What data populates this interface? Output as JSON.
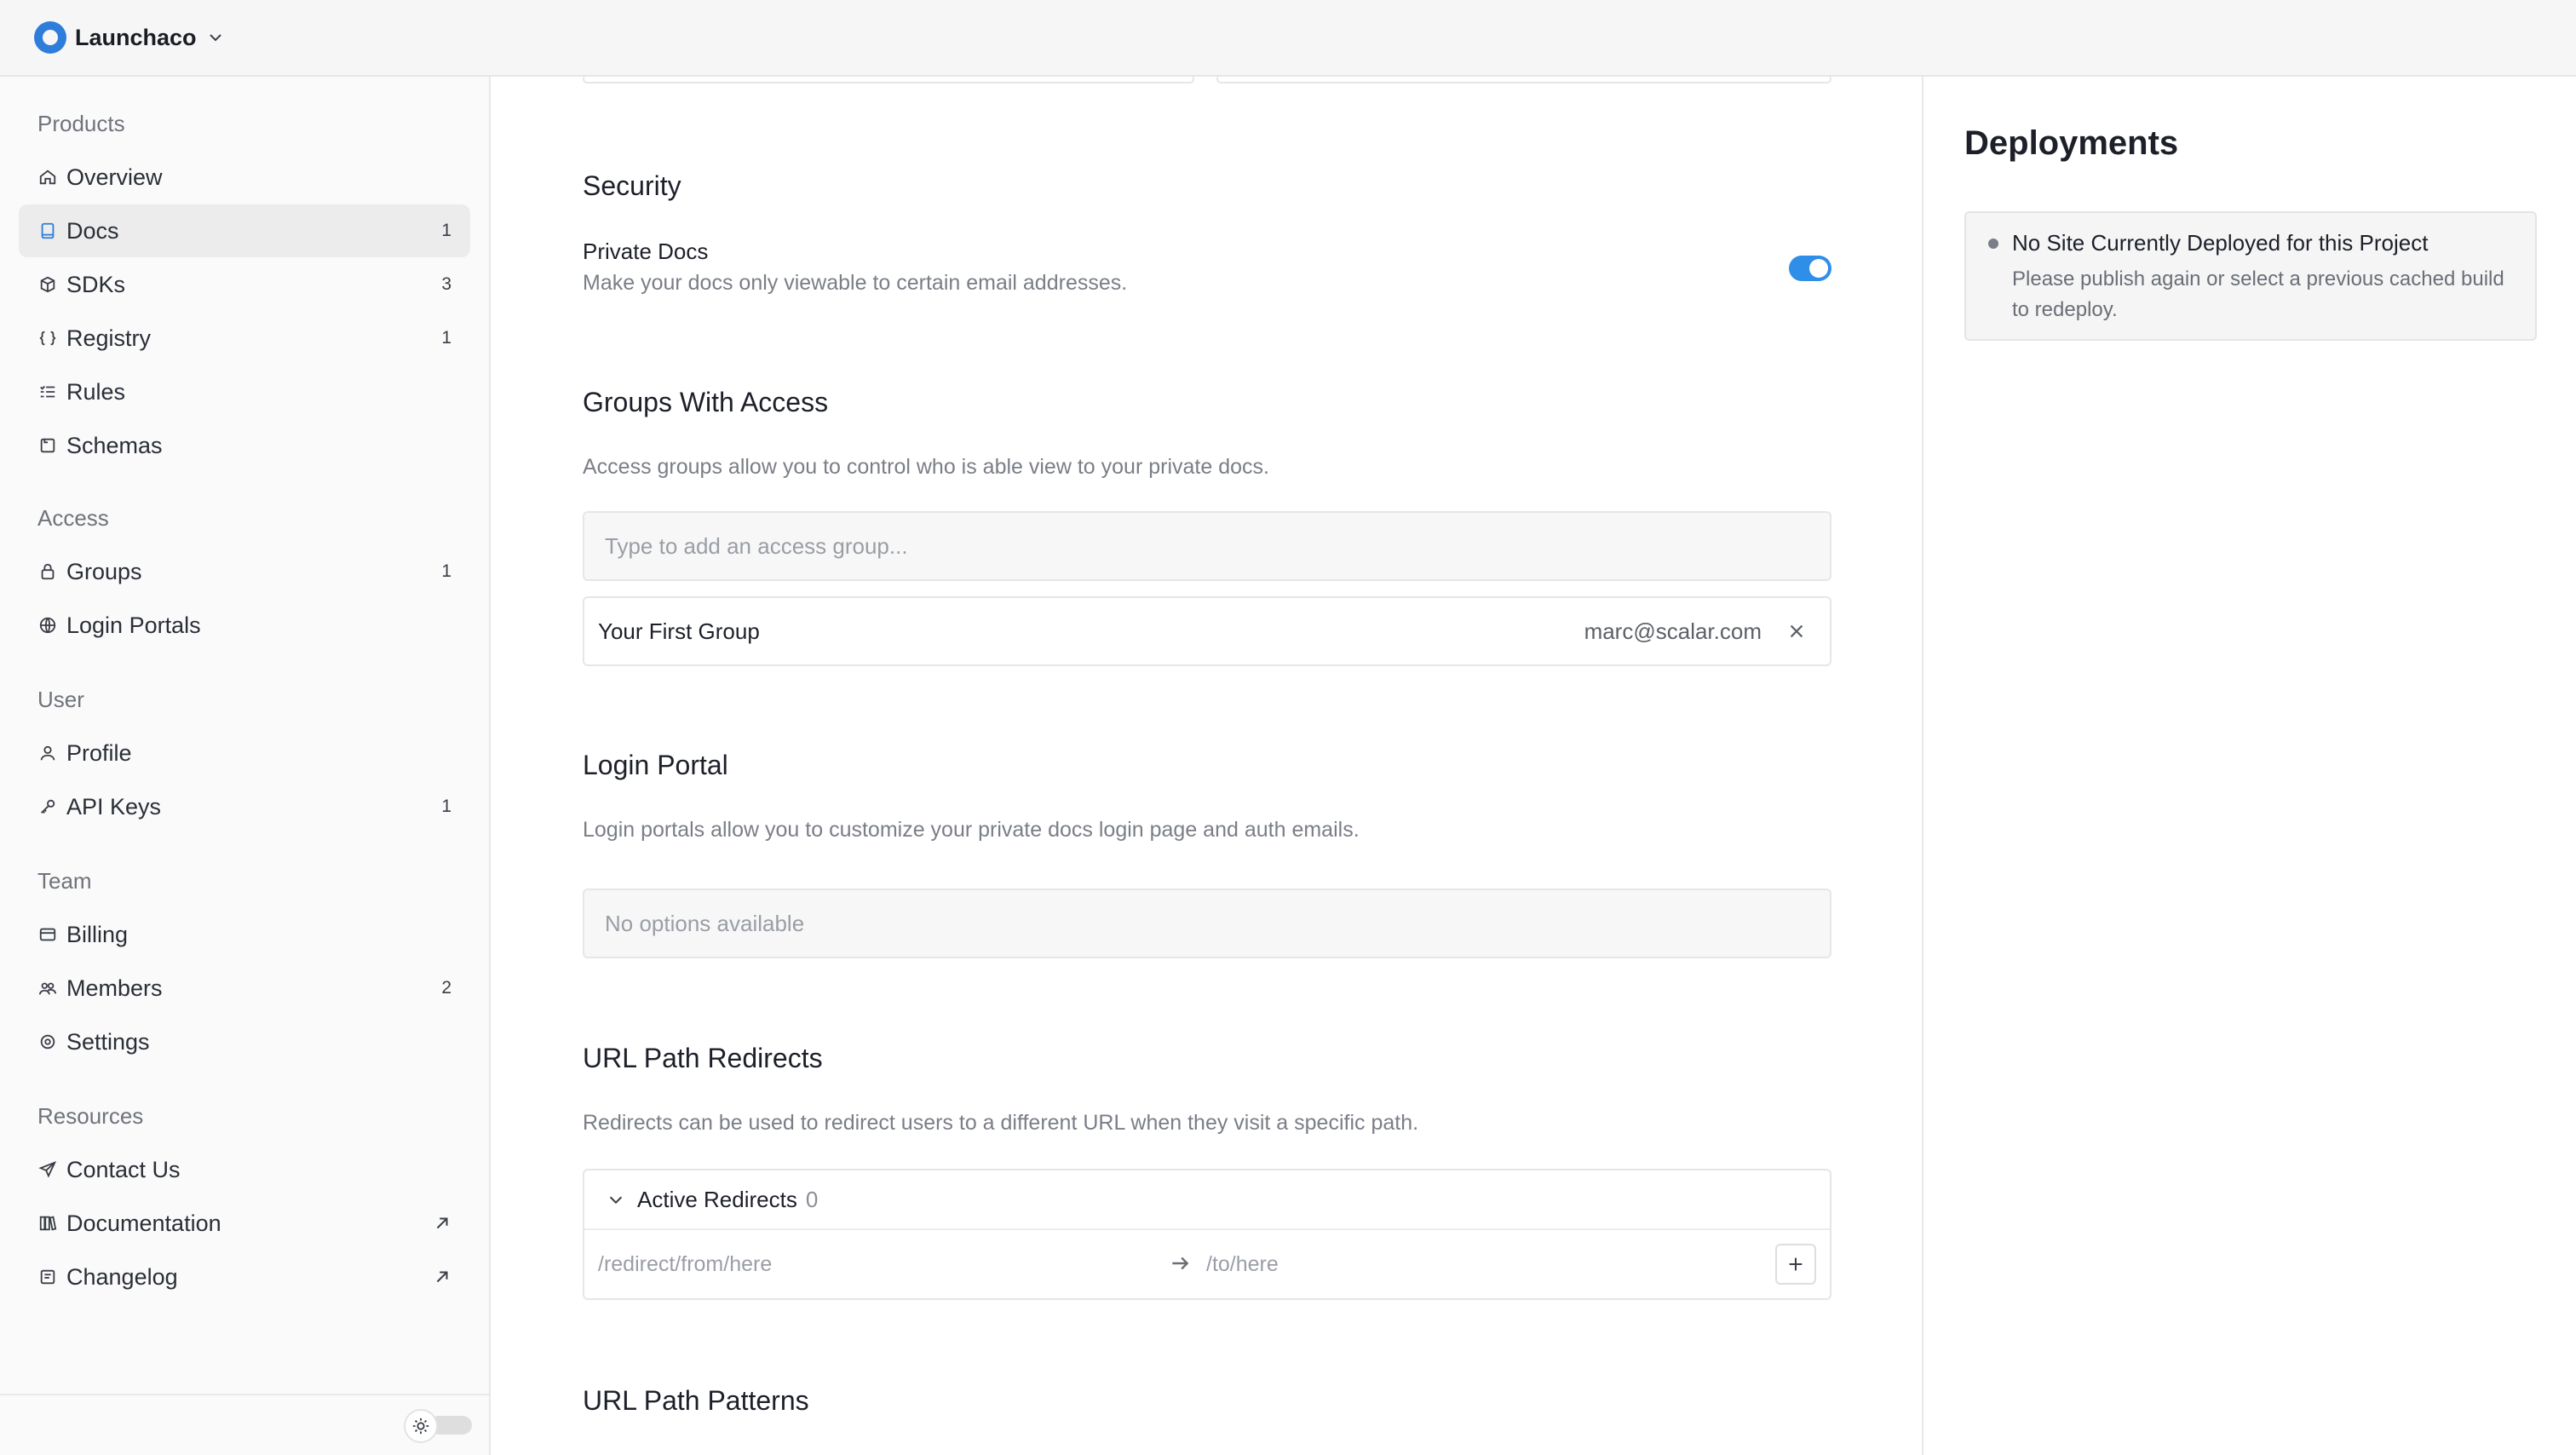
{
  "topbar": {
    "team_name": "Launchaco"
  },
  "sidebar": {
    "sections": [
      {
        "title": "Products"
      },
      {
        "title": "Access"
      },
      {
        "title": "User"
      },
      {
        "title": "Team"
      },
      {
        "title": "Resources"
      }
    ],
    "items": [
      {
        "label": "Overview",
        "icon": "home-icon",
        "count": ""
      },
      {
        "label": "Docs",
        "icon": "book-icon",
        "count": "1"
      },
      {
        "label": "SDKs",
        "icon": "package-icon",
        "count": "3"
      },
      {
        "label": "Registry",
        "icon": "braces-icon",
        "count": "1"
      },
      {
        "label": "Rules",
        "icon": "list-check-icon",
        "count": ""
      },
      {
        "label": "Schemas",
        "icon": "schema-icon",
        "count": ""
      },
      {
        "label": "Groups",
        "icon": "lock-icon",
        "count": "1"
      },
      {
        "label": "Login Portals",
        "icon": "globe-icon",
        "count": ""
      },
      {
        "label": "Profile",
        "icon": "user-icon",
        "count": ""
      },
      {
        "label": "API Keys",
        "icon": "key-icon",
        "count": "1"
      },
      {
        "label": "Billing",
        "icon": "card-icon",
        "count": ""
      },
      {
        "label": "Members",
        "icon": "users-icon",
        "count": "2"
      },
      {
        "label": "Settings",
        "icon": "gear-icon",
        "count": ""
      },
      {
        "label": "Contact Us",
        "icon": "send-icon",
        "count": ""
      },
      {
        "label": "Documentation",
        "icon": "library-icon",
        "count": ""
      },
      {
        "label": "Changelog",
        "icon": "notes-icon",
        "count": ""
      }
    ]
  },
  "main": {
    "security": {
      "title": "Security",
      "private_docs_label": "Private Docs",
      "private_docs_desc": "Make your docs only viewable to certain email addresses.",
      "private_docs_enabled": true
    },
    "groups": {
      "title": "Groups With Access",
      "desc": "Access groups allow you to control who is able view to your private docs.",
      "placeholder": "Type to add an access group...",
      "items": [
        {
          "name": "Your First Group",
          "email": "marc@scalar.com"
        }
      ]
    },
    "login_portal": {
      "title": "Login Portal",
      "desc": "Login portals allow you to customize your private docs login page and auth emails.",
      "empty": "No options available"
    },
    "redirects": {
      "title": "URL Path Redirects",
      "desc": "Redirects can be used to redirect users to a different URL when they visit a specific path.",
      "active_label": "Active Redirects",
      "active_count": "0",
      "from_placeholder": "/redirect/from/here",
      "to_placeholder": "/to/here"
    },
    "patterns": {
      "title": "URL Path Patterns"
    }
  },
  "right": {
    "title": "Deployments",
    "status_title": "No Site Currently Deployed for this Project",
    "status_msg": "Please publish again or select a previous cached build to redeploy."
  }
}
